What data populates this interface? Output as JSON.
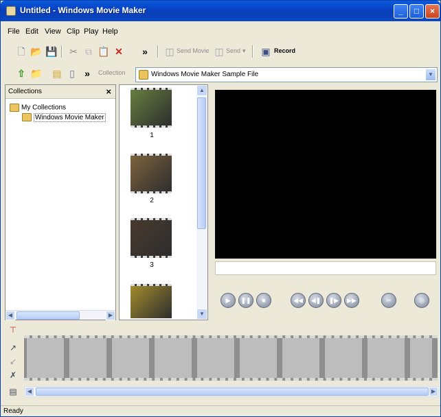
{
  "window": {
    "title": "Untitled - Windows Movie Maker",
    "minimize": "_",
    "maximize": "□",
    "close": "×"
  },
  "menu": [
    "File",
    "Edit",
    "View",
    "Clip",
    "Play",
    "Help"
  ],
  "toolbar": {
    "more": "»",
    "send_movie_label": "Send Movie",
    "send_label": "Send",
    "record_label": "Record"
  },
  "collection_bar": {
    "label": "Collection",
    "value": "Windows Movie Maker Sample File",
    "more": "»"
  },
  "collections_pane": {
    "title": "Collections",
    "close": "×",
    "root": "My Collections",
    "child": "Windows Movie Maker"
  },
  "clips": [
    {
      "number": "1",
      "color": "#6f8b3f"
    },
    {
      "number": "2",
      "color": "#8a6a3e"
    },
    {
      "number": "3",
      "color": "#4a3a2c"
    },
    {
      "number": "",
      "color": "#b59a2a"
    }
  ],
  "player_controls": [
    {
      "icon": "play-icon",
      "glyph": "▶"
    },
    {
      "icon": "pause-icon",
      "glyph": "❚❚"
    },
    {
      "icon": "stop-icon",
      "glyph": "■"
    },
    {
      "icon": "rewind-icon",
      "glyph": "◀◀"
    },
    {
      "icon": "previous-frame-icon",
      "glyph": "◀❚"
    },
    {
      "icon": "next-frame-icon",
      "glyph": "❚▶"
    },
    {
      "icon": "fast-forward-icon",
      "glyph": "▶▶"
    },
    {
      "icon": "split-icon",
      "glyph": "✂"
    },
    {
      "icon": "snapshot-icon",
      "glyph": "◎"
    }
  ],
  "status": {
    "text": "Ready"
  }
}
